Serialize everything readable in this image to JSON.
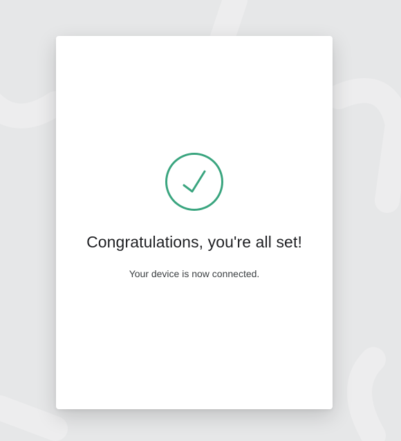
{
  "colors": {
    "page_background": "#e6e7e8",
    "card_background": "#ffffff",
    "success_accent": "#3aa57f",
    "title_text": "#202124",
    "body_text": "#3c4043"
  },
  "icons": {
    "status": "checkmark-circle-icon"
  },
  "card": {
    "title": "Congratulations, you're all set!",
    "message": "Your device is now connected."
  }
}
